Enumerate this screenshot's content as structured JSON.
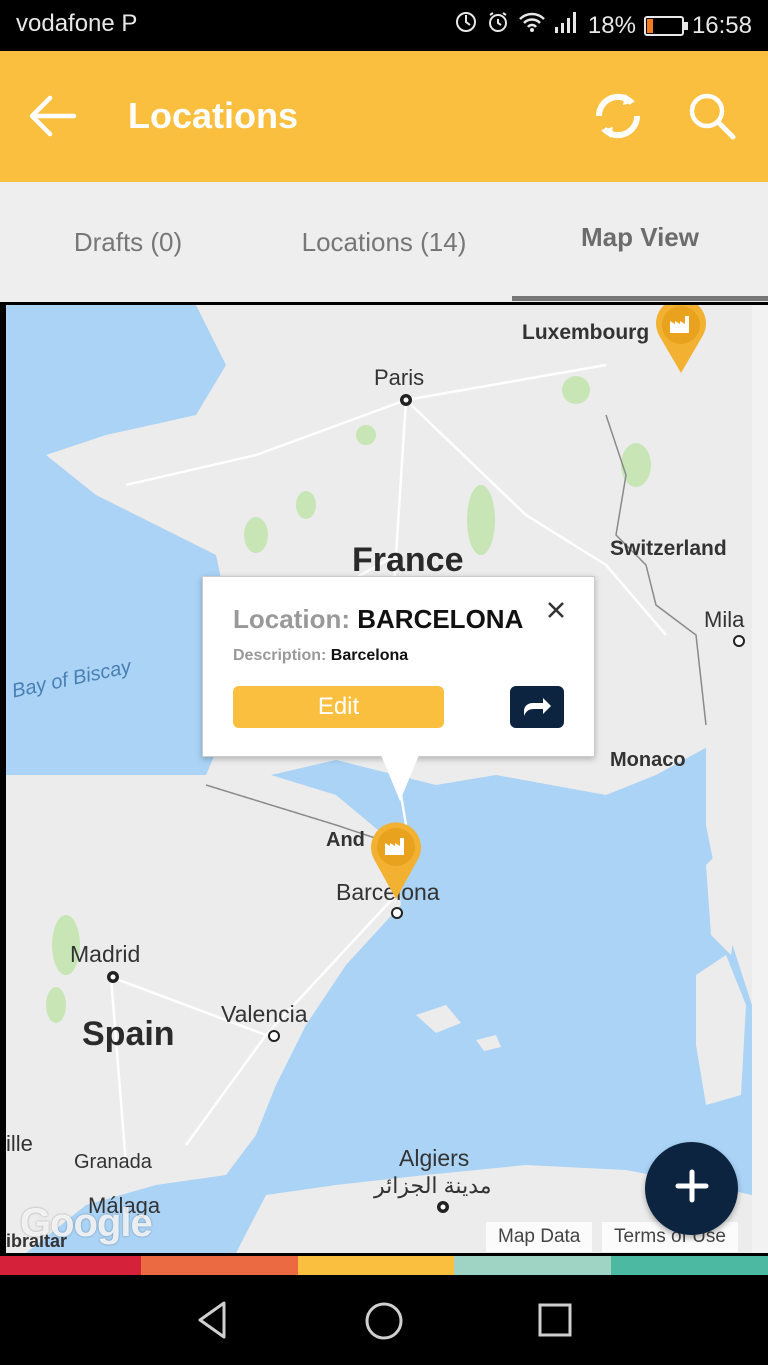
{
  "status_bar": {
    "carrier": "vodafone P",
    "battery": "18%",
    "time": "16:58",
    "battery_level": 0.18
  },
  "app_bar": {
    "title": "Locations",
    "back_icon": "arrow-left-icon",
    "refresh_icon": "refresh-icon",
    "search_icon": "search-icon"
  },
  "tabs": [
    {
      "label": "Drafts (0)",
      "active": false
    },
    {
      "label": "Locations (14)",
      "active": false
    },
    {
      "label": "Map View",
      "active": true
    }
  ],
  "map": {
    "labels": {
      "luxembourg": "Luxembourg",
      "paris": "Paris",
      "france": "France",
      "switzerland": "Switzerland",
      "milan": "Mila",
      "bay_of_biscay": "Bay of Biscay",
      "monaco": "Monaco",
      "andorra": "And",
      "barcelona": "Barcelona",
      "madrid": "Madrid",
      "valencia": "Valencia",
      "spain": "Spain",
      "seville": "ille",
      "granada": "Granada",
      "algiers": "Algiers",
      "algiers_arabic": "مدينة الجزائر",
      "malaga": "Málaga",
      "gibraltar": "ibraltar"
    },
    "google_logo": "Google",
    "map_data": "Map Data",
    "terms": "Terms of Use",
    "marker_icon": "factory-pin-icon"
  },
  "popup": {
    "location_label": "Location:",
    "location_value": "BARCELONA",
    "description_label": "Description:",
    "description_value": "Barcelona",
    "edit_label": "Edit",
    "close_icon": "close-icon",
    "share_icon": "share-arrow-icon"
  },
  "fab_icon": "plus-icon",
  "colors": {
    "primary": "#fbbf3f",
    "dark": "#0d2440",
    "stripe": [
      "#d6213a",
      "#ec6a42",
      "#fbbf3f",
      "#9fd3c3",
      "#4cb9a2"
    ]
  }
}
